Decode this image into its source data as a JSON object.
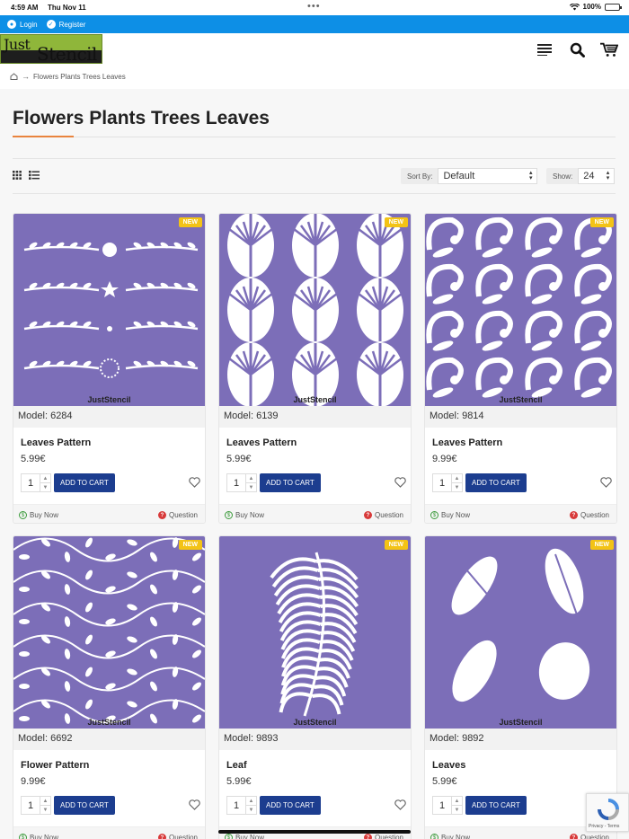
{
  "status_bar": {
    "time": "4:59 AM",
    "date": "Thu Nov 11",
    "battery": "100%"
  },
  "topbar": {
    "login": "Login",
    "register": "Register"
  },
  "logo": {
    "line1": "Just",
    "line2": "Stencil"
  },
  "breadcrumb": {
    "current": "Flowers Plants Trees Leaves"
  },
  "page_title": "Flowers Plants Trees Leaves",
  "sort": {
    "label": "Sort By:",
    "value": "Default"
  },
  "show": {
    "label": "Show:",
    "value": "24"
  },
  "labels": {
    "add_to_cart": "ADD TO CART",
    "buy_now": "Buy Now",
    "question": "Question",
    "new_badge": "NEW",
    "brand": "JustStencil"
  },
  "colors": {
    "topbar": "#0d8fe6",
    "stencil": "#7c6eb8",
    "cart_button": "#1c3d8f",
    "badge": "#f3c316",
    "accent": "#e9843e"
  },
  "products": [
    {
      "model": "Model: 6284",
      "name": "Leaves Pattern",
      "price": "5.99€",
      "qty": "1"
    },
    {
      "model": "Model: 6139",
      "name": "Leaves Pattern",
      "price": "5.99€",
      "qty": "1"
    },
    {
      "model": "Model: 9814",
      "name": "Leaves Pattern",
      "price": "9.99€",
      "qty": "1"
    },
    {
      "model": "Model: 6692",
      "name": "Flower Pattern",
      "price": "9.99€",
      "qty": "1"
    },
    {
      "model": "Model: 9893",
      "name": "Leaf",
      "price": "5.99€",
      "qty": "1"
    },
    {
      "model": "Model: 9892",
      "name": "Leaves",
      "price": "5.99€",
      "qty": "1"
    }
  ],
  "recaptcha": {
    "text": "Privacy - Terms"
  }
}
